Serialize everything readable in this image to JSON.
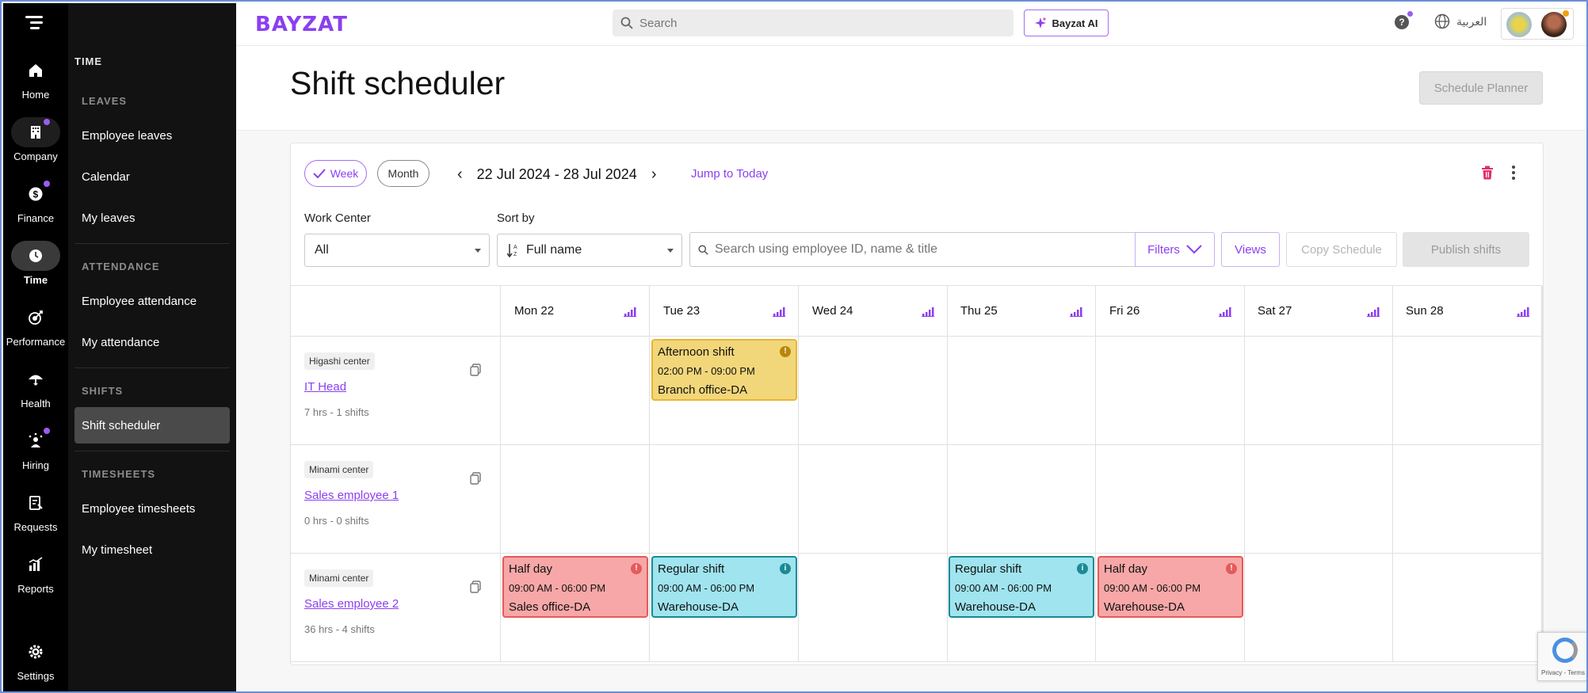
{
  "brand": {
    "logo_text": "BAYZAT",
    "accent": "#8b3ff0"
  },
  "rail": [
    {
      "label": "Home",
      "icon": "home-icon"
    },
    {
      "label": "Company",
      "icon": "building-icon",
      "badge": true
    },
    {
      "label": "Finance",
      "icon": "dollar-icon",
      "badge": true
    },
    {
      "label": "Time",
      "icon": "clock-icon",
      "active": true
    },
    {
      "label": "Performance",
      "icon": "target-icon"
    },
    {
      "label": "Health",
      "icon": "umbrella-icon"
    },
    {
      "label": "Hiring",
      "icon": "hiring-icon",
      "badge": true
    },
    {
      "label": "Requests",
      "icon": "requests-icon"
    },
    {
      "label": "Reports",
      "icon": "reports-icon"
    },
    {
      "label": "Settings",
      "icon": "gear-icon"
    }
  ],
  "subnav": {
    "section": "TIME",
    "groups": [
      {
        "title": "LEAVES",
        "items": [
          "Employee leaves",
          "Calendar",
          "My leaves"
        ]
      },
      {
        "title": "ATTENDANCE",
        "items": [
          "Employee attendance",
          "My attendance"
        ]
      },
      {
        "title": "SHIFTS",
        "items": [
          "Shift scheduler"
        ]
      },
      {
        "title": "TIMESHEETS",
        "items": [
          "Employee timesheets",
          "My timesheet"
        ]
      }
    ],
    "active_item": "Shift scheduler"
  },
  "topbar": {
    "search_placeholder": "Search",
    "ai_label": "Bayzat AI",
    "help_label": "?",
    "language": "العربية"
  },
  "page": {
    "title": "Shift scheduler",
    "schedule_planner_label": "Schedule Planner"
  },
  "toolbar": {
    "view_week": "Week",
    "view_month": "Month",
    "selected_view": "Week",
    "date_range": "22 Jul 2024 - 28 Jul 2024",
    "jump_today": "Jump to Today",
    "work_center_label": "Work Center",
    "work_center_value": "All",
    "sort_label": "Sort by",
    "sort_value": "Full name",
    "employee_search_placeholder": "Search using employee ID, name & title",
    "filters_label": "Filters",
    "views_label": "Views",
    "copy_schedule_label": "Copy Schedule",
    "publish_label": "Publish shifts"
  },
  "days": [
    "Mon 22",
    "Tue 23",
    "Wed 24",
    "Thu 25",
    "Fri 26",
    "Sat 27",
    "Sun 28"
  ],
  "employees": [
    {
      "center": "Higashi center",
      "name": "IT Head",
      "summary": "7 hrs - 1 shifts",
      "shifts": [
        {
          "day": 1,
          "title": "Afternoon shift",
          "time": "02:00 PM - 09:00 PM",
          "location": "Branch office-DA",
          "color": "yellow"
        }
      ]
    },
    {
      "center": "Minami center",
      "name": "Sales employee 1",
      "summary": "0 hrs - 0 shifts",
      "shifts": []
    },
    {
      "center": "Minami center",
      "name": "Sales employee 2",
      "summary": "36 hrs - 4 shifts",
      "shifts": [
        {
          "day": 0,
          "title": "Half day",
          "time": "09:00 AM - 06:00 PM",
          "location": "Sales office-DA",
          "color": "red"
        },
        {
          "day": 1,
          "title": "Regular shift",
          "time": "09:00 AM - 06:00 PM",
          "location": "Warehouse-DA",
          "color": "teal"
        },
        {
          "day": 3,
          "title": "Regular shift",
          "time": "09:00 AM - 06:00 PM",
          "location": "Warehouse-DA",
          "color": "teal"
        },
        {
          "day": 4,
          "title": "Half day",
          "time": "09:00 AM - 06:00 PM",
          "location": "Warehouse-DA",
          "color": "red"
        }
      ]
    }
  ],
  "recaptcha_text": "Privacy - Terms"
}
